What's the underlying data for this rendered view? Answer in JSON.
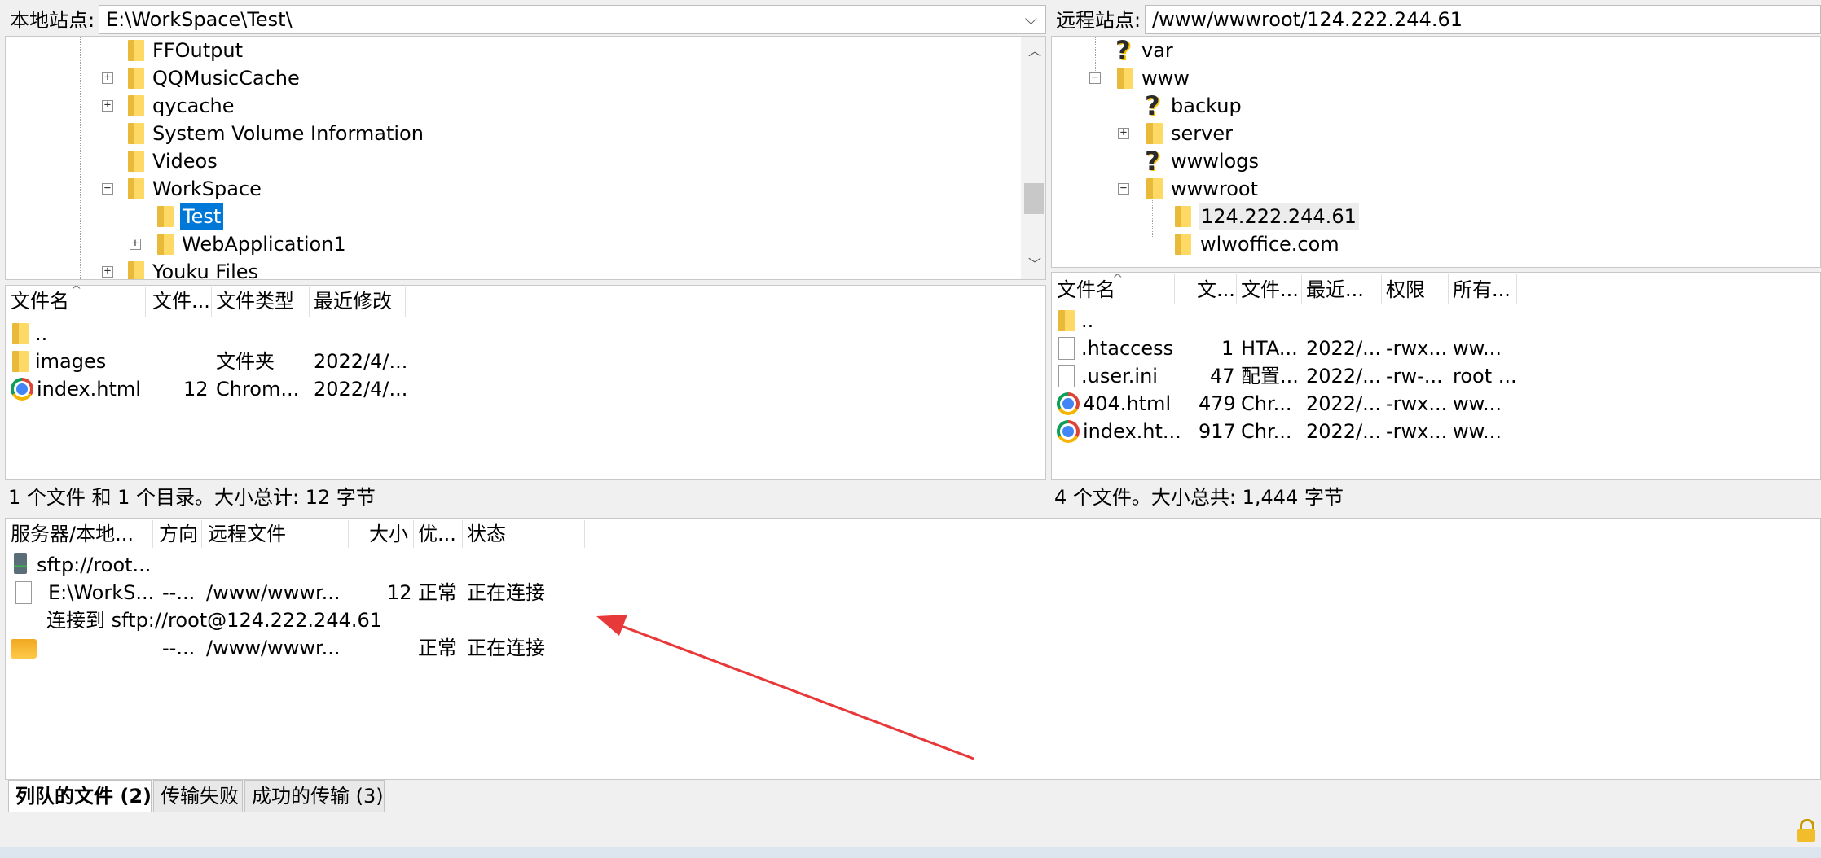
{
  "local": {
    "label": "本地站点:",
    "path": "E:\\WorkSpace\\Test\\",
    "tree": [
      {
        "name": "FFOutput",
        "expander": ""
      },
      {
        "name": "QQMusicCache",
        "expander": "+"
      },
      {
        "name": "qycache",
        "expander": "+"
      },
      {
        "name": "System Volume Information",
        "expander": ""
      },
      {
        "name": "Videos",
        "expander": ""
      },
      {
        "name": "WorkSpace",
        "expander": "−"
      },
      {
        "name": "Test",
        "expander": ""
      },
      {
        "name": "WebApplication1",
        "expander": "+"
      },
      {
        "name": "Youku Files",
        "expander": "+"
      }
    ],
    "headers": [
      "文件名",
      "文件...",
      "文件类型",
      "最近修改"
    ],
    "files": [
      {
        "name": "..",
        "size": "",
        "type": "",
        "modified": ""
      },
      {
        "name": "images",
        "size": "",
        "type": "文件夹",
        "modified": "2022/4/..."
      },
      {
        "name": "index.html",
        "size": "12",
        "type": "Chrom...",
        "modified": "2022/4/..."
      }
    ],
    "status": "1 个文件 和 1 个目录。大小总计: 12 字节"
  },
  "remote": {
    "label": "远程站点:",
    "path": "/www/wwwroot/124.222.244.61",
    "tree": [
      {
        "name": "var",
        "expander": ""
      },
      {
        "name": "www",
        "expander": "−"
      },
      {
        "name": "backup",
        "expander": ""
      },
      {
        "name": "server",
        "expander": "+"
      },
      {
        "name": "wwwlogs",
        "expander": ""
      },
      {
        "name": "wwwroot",
        "expander": "−"
      },
      {
        "name": "124.222.244.61",
        "expander": ""
      },
      {
        "name": "wlwoffice.com",
        "expander": ""
      }
    ],
    "headers": [
      "文件名",
      "文...",
      "文件...",
      "最近...",
      "权限",
      "所有..."
    ],
    "files": [
      {
        "name": "..",
        "size": "",
        "type": "",
        "modified": "",
        "perm": "",
        "owner": ""
      },
      {
        "name": ".htaccess",
        "size": "1",
        "type": "HTA...",
        "modified": "2022/...",
        "perm": "-rwx...",
        "owner": "ww..."
      },
      {
        "name": ".user.ini",
        "size": "47",
        "type": "配置...",
        "modified": "2022/...",
        "perm": "-rw-...",
        "owner": "root ..."
      },
      {
        "name": "404.html",
        "size": "479",
        "type": "Chr...",
        "modified": "2022/...",
        "perm": "-rwx...",
        "owner": "ww..."
      },
      {
        "name": "index.ht...",
        "size": "917",
        "type": "Chr...",
        "modified": "2022/...",
        "perm": "-rwx...",
        "owner": "ww..."
      }
    ],
    "status": "4 个文件。大小总共: 1,444 字节"
  },
  "queue": {
    "headers": [
      "服务器/本地...",
      "方向",
      "远程文件",
      "大小",
      "优...",
      "状态"
    ],
    "server": "sftp://root...",
    "rows": [
      {
        "local": "E:\\WorkS...",
        "dir": "--...",
        "remote": "/www/wwwr...",
        "size": "12",
        "prio": "正常",
        "status": "正在连接"
      },
      {
        "local": "",
        "dir": "--...",
        "remote": "/www/wwwr...",
        "size": "",
        "prio": "正常",
        "status": "正在连接"
      }
    ],
    "message": "连接到 sftp://root@124.222.244.61"
  },
  "tabs": [
    "列队的文件 (2)",
    "传输失败",
    "成功的传输 (3)"
  ],
  "colors": {
    "selection": "#0078d7",
    "arrow": "#e8393a"
  }
}
